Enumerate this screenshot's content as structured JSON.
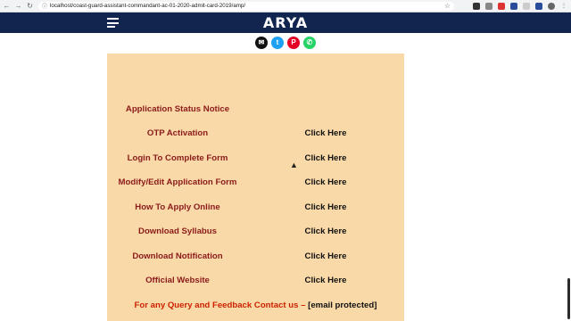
{
  "browser": {
    "url": "localhost/coast-guard-assistant-commandant-ac-01-2020-admit-card-2019/amp/",
    "back": "←",
    "forward": "→",
    "reload": "↻",
    "lock": "ⓘ",
    "star": "☆"
  },
  "header": {
    "brand": "ARYA"
  },
  "share": {
    "email": "✉",
    "twitter": "t",
    "pinterest": "P",
    "whatsapp": "✆"
  },
  "content": {
    "notice": "Application Status Notice",
    "rows": [
      {
        "label": "OTP Activation",
        "action": "Click Here"
      },
      {
        "label": "Login To Complete Form",
        "action": "Click Here"
      },
      {
        "label": "Modify/Edit Application Form",
        "action": "Click Here"
      },
      {
        "label": "How To Apply Online",
        "action": "Click Here"
      },
      {
        "label": "Download Syllabus",
        "action": "Click Here"
      },
      {
        "label": "Download Notification",
        "action": "Click Here"
      },
      {
        "label": "Official Website",
        "action": "Click Here"
      }
    ],
    "query_text": "For any Query and Feedback Contact us –",
    "email_text": "[email protected]"
  },
  "colors": {
    "header_bg": "#11254f",
    "content_bg": "#f9d9a8",
    "label": "#8b1a1a",
    "query": "#cc2200"
  }
}
